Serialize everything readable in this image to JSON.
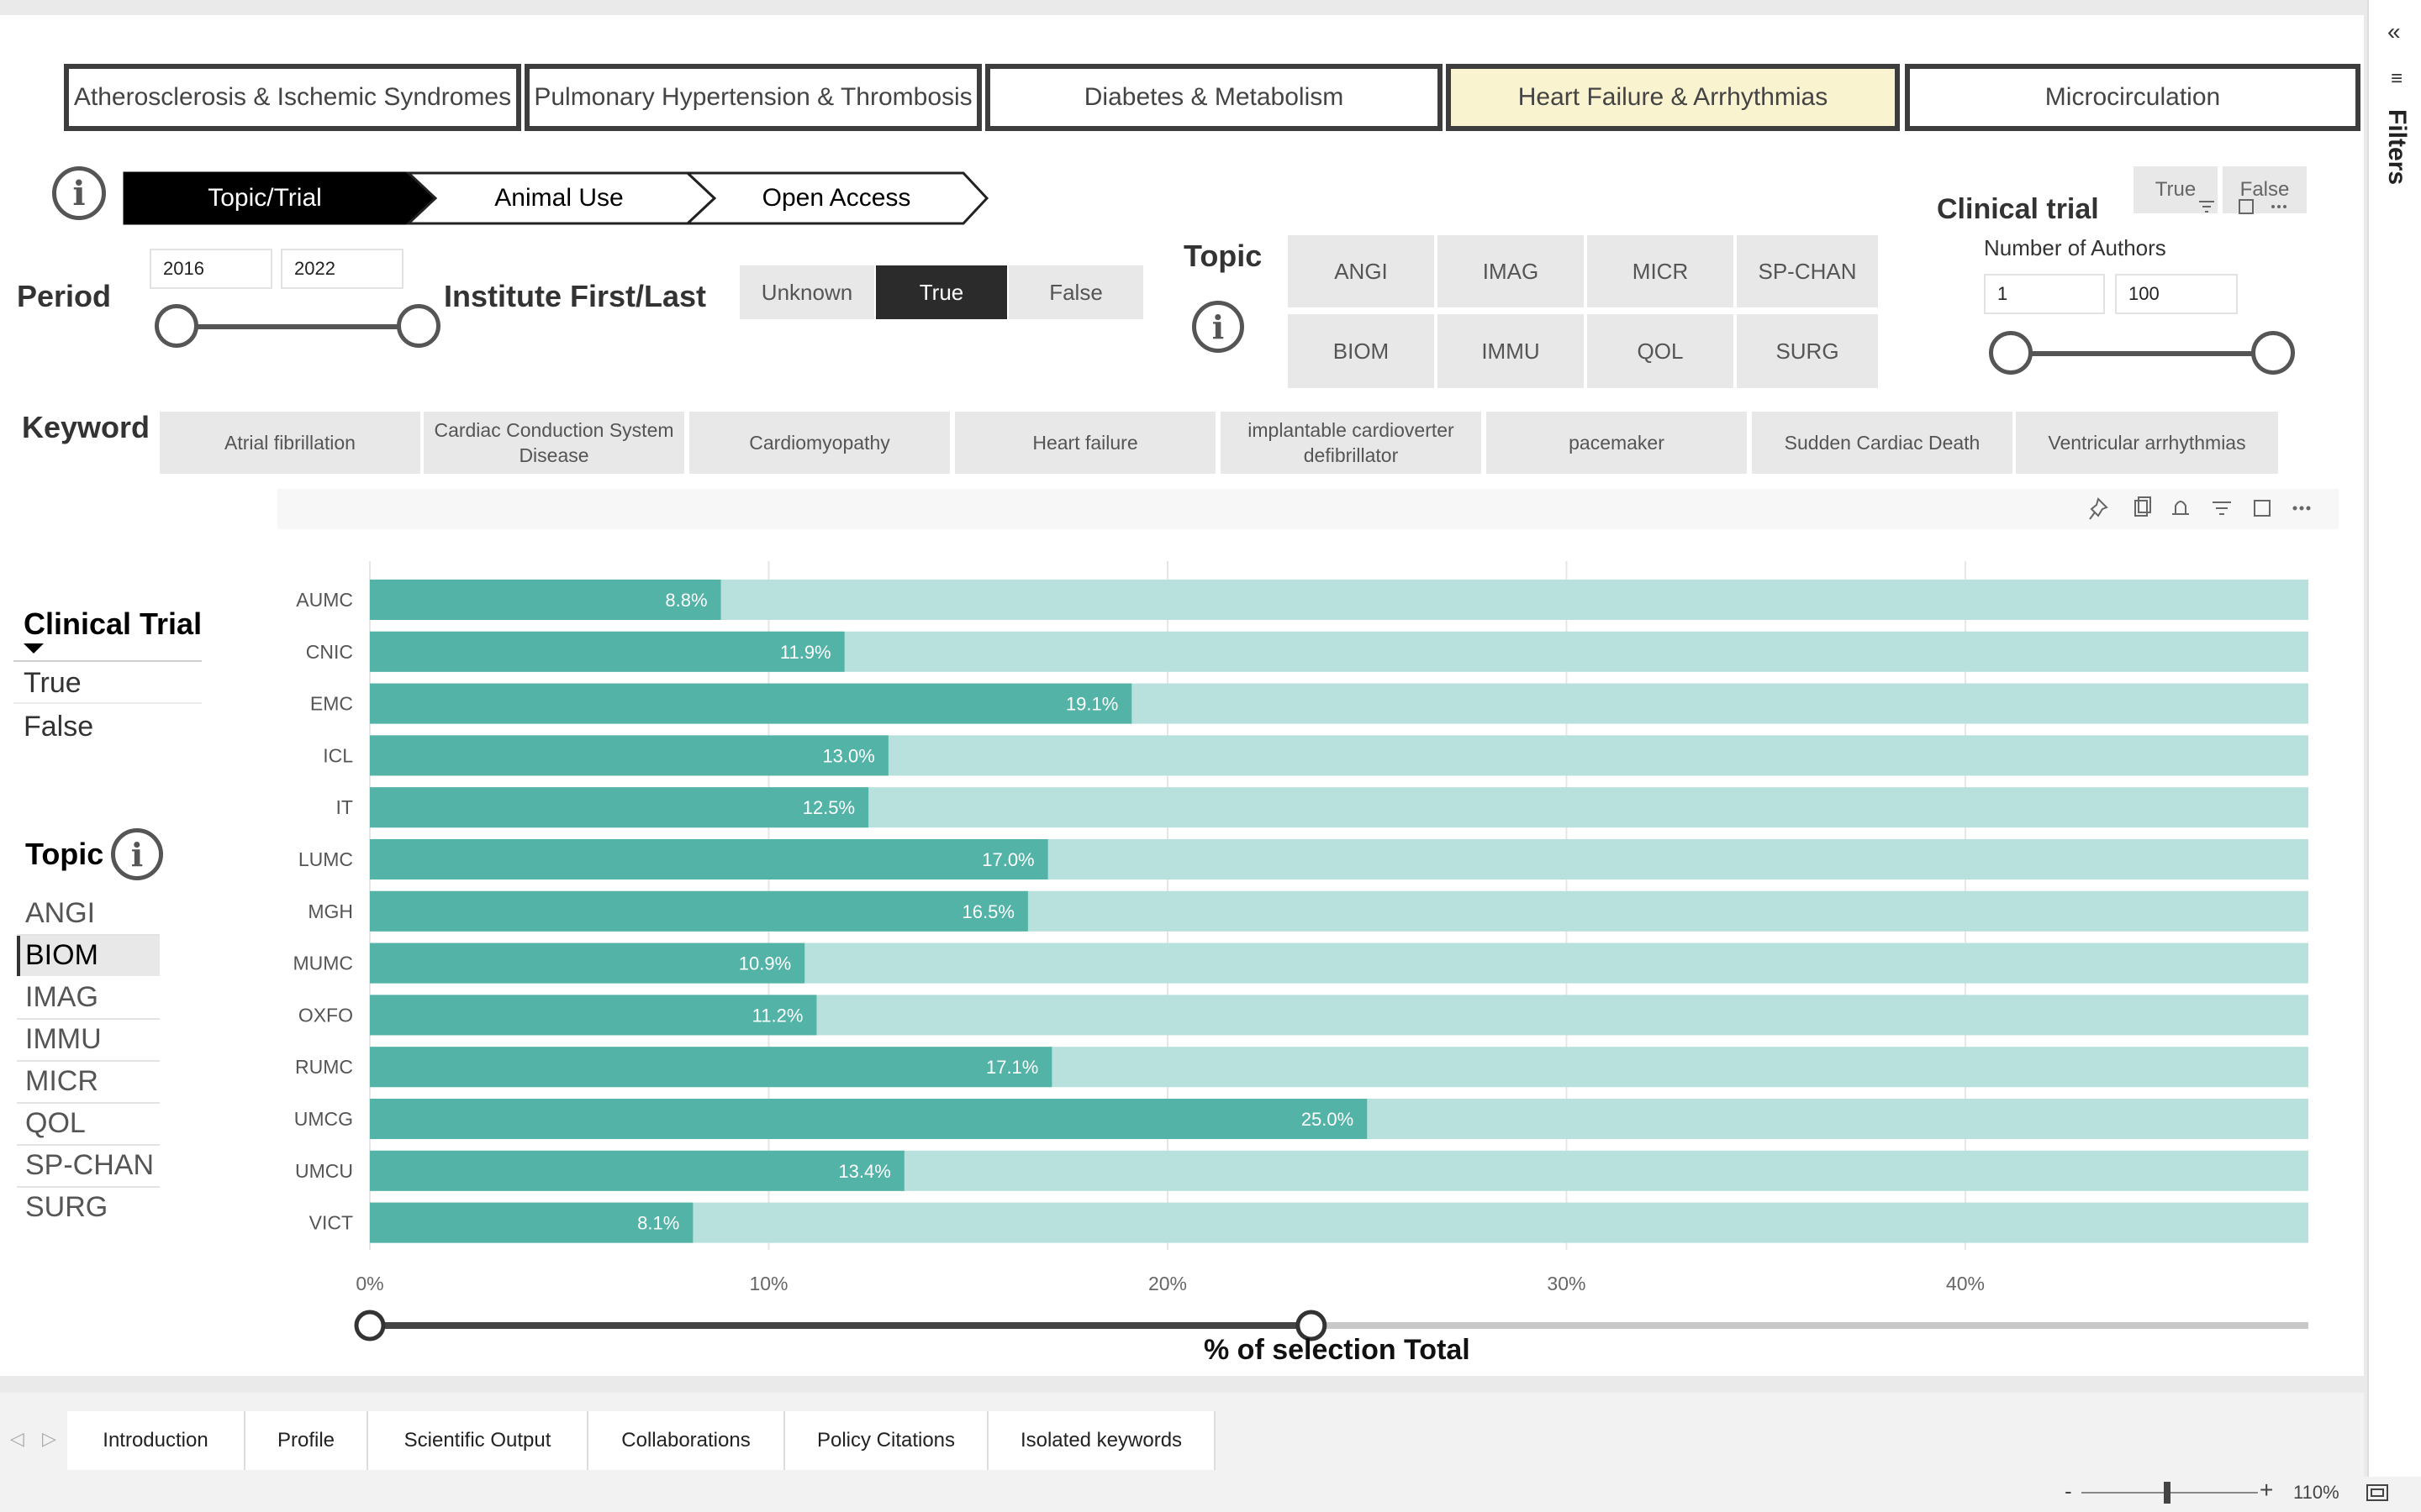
{
  "header_tabs": [
    {
      "label": "Atherosclerosis & Ischemic Syndromes",
      "active": false
    },
    {
      "label": "Pulmonary Hypertension & Thrombosis",
      "active": false
    },
    {
      "label": "Diabetes & Metabolism",
      "active": false
    },
    {
      "label": "Heart Failure & Arrhythmias",
      "active": true
    },
    {
      "label": "Microcirculation",
      "active": false
    }
  ],
  "nav": {
    "items": [
      "Topic/Trial",
      "Animal Use",
      "Open Access"
    ],
    "active": "Topic/Trial",
    "info_icon": "info-icon"
  },
  "period": {
    "label": "Period",
    "from": "2016",
    "to": "2022"
  },
  "institute": {
    "label": "Institute First/Last",
    "options": [
      "Unknown",
      "True",
      "False"
    ],
    "selected": "True"
  },
  "topic_filter": {
    "label": "Topic",
    "tiles": [
      "ANGI",
      "IMAG",
      "MICR",
      "SP-CHAN",
      "BIOM",
      "IMMU",
      "QOL",
      "SURG"
    ]
  },
  "clinical_trial_top": {
    "label": "Clinical trial",
    "options": [
      "True",
      "False"
    ]
  },
  "authors": {
    "label": "Number of Authors",
    "min": "1",
    "max": "100"
  },
  "keyword": {
    "label": "Keyword",
    "items": [
      "Atrial fibrillation",
      "Cardiac Conduction System Disease",
      "Cardiomyopathy",
      "Heart failure",
      "implantable cardioverter defibrillator",
      "pacemaker",
      "Sudden Cardiac Death",
      "Ventricular arrhythmias"
    ]
  },
  "clinical_trial_list": {
    "label": "Clinical Trial",
    "items": [
      "True",
      "False"
    ]
  },
  "topic_list": {
    "label": "Topic",
    "items": [
      "ANGI",
      "BIOM",
      "IMAG",
      "IMMU",
      "MICR",
      "QOL",
      "SP-CHAN",
      "SURG"
    ],
    "selected": "BIOM"
  },
  "chart_data": {
    "type": "bar",
    "orientation": "horizontal",
    "categories": [
      "AUMC",
      "CNIC",
      "EMC",
      "ICL",
      "IT",
      "LUMC",
      "MGH",
      "MUMC",
      "OXFO",
      "RUMC",
      "UMCG",
      "UMCU",
      "VICT"
    ],
    "values": [
      8.8,
      11.9,
      19.1,
      13.0,
      12.5,
      17.0,
      16.5,
      10.9,
      11.2,
      17.1,
      25.0,
      13.4,
      8.1
    ],
    "data_labels": [
      "8.8%",
      "11.9%",
      "19.1%",
      "13.0%",
      "12.5%",
      "17.0%",
      "16.5%",
      "10.9%",
      "11.2%",
      "17.1%",
      "25.0%",
      "13.4%",
      "8.1%"
    ],
    "background_bar_max": 48.6,
    "xlim": [
      0,
      48.6
    ],
    "xticks": [
      "0%",
      "10%",
      "20%",
      "30%",
      "40%"
    ],
    "xtick_values": [
      0,
      10,
      20,
      30,
      40
    ],
    "xlabel": "% of selection Total",
    "range_slider": [
      0,
      23.6
    ],
    "bar_color": "#52b3a6",
    "background_color": "#b8e0dc",
    "grid": true
  },
  "visual_toolbar_icons": [
    "pin-icon",
    "copy-icon",
    "bell-icon",
    "filter-icon",
    "focus-mode-icon",
    "more-options-icon"
  ],
  "filters_pane": {
    "label": "Filters",
    "collapse_icon": "double-chevron-left-icon"
  },
  "page_tabs": [
    "Introduction",
    "Profile",
    "Scientific Output",
    "Collaborations",
    "Policy Citations",
    "Isolated keywords"
  ],
  "status": {
    "zoom": "110%",
    "minus": "-",
    "plus": "+"
  }
}
